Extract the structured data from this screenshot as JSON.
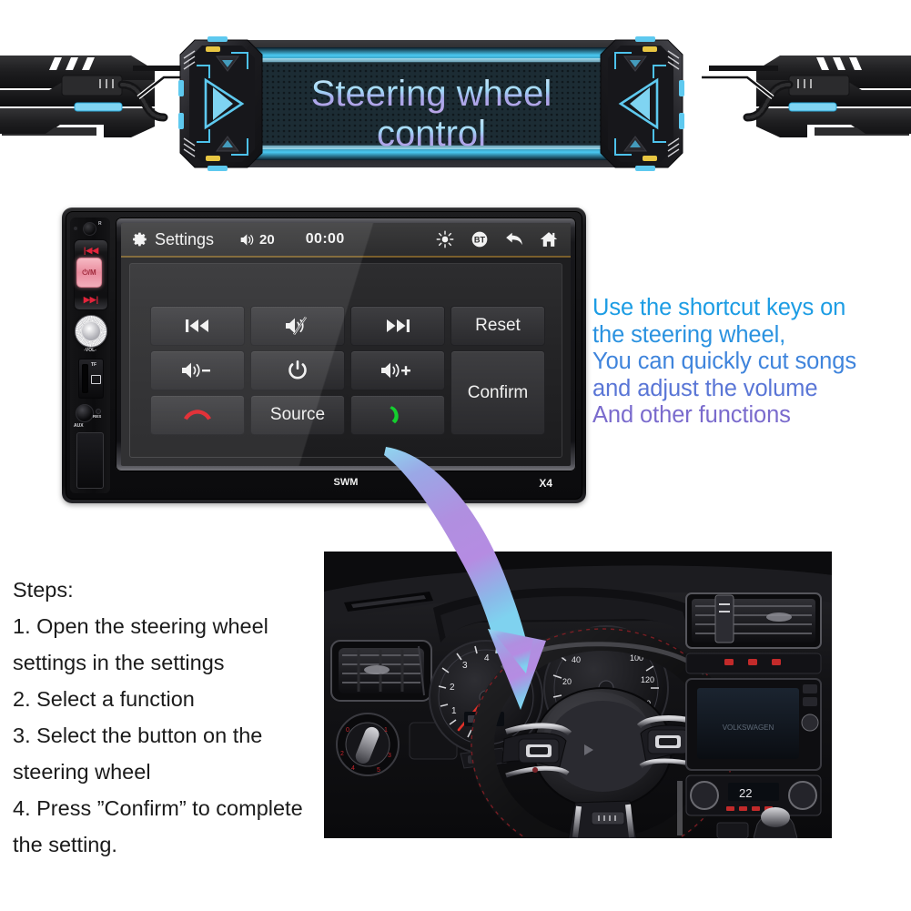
{
  "banner": {
    "title_line1": "Steering wheel",
    "title_line2": "control",
    "left_arrow_icon": "play-triangle-right-icon",
    "right_arrow_icon": "play-triangle-left-icon",
    "accent_cyan": "#56c8f0",
    "accent_purple": "#b3a0e8"
  },
  "stereo": {
    "model_label": "X4",
    "mode_label": "SWM",
    "side_panel": {
      "mic_icon": "microphone-icon",
      "prev_label": "|◀◀",
      "next_label": "▶▶|",
      "power_label": "⏻/M",
      "volume_label": "-VOL-",
      "tf_label": "TF",
      "aux_label": "AUX",
      "res_label": "RES"
    },
    "topbar": {
      "gear_icon": "gear-icon",
      "settings_label": "Settings",
      "volume_icon": "speaker-icon",
      "volume_value": "20",
      "clock": "00:00",
      "brightness_icon": "brightness-sun-icon",
      "bluetooth_icon": "bluetooth-bt-icon",
      "back_icon": "back-arrow-icon",
      "home_icon": "home-icon"
    },
    "keys": [
      {
        "id": "prev-track",
        "icon": "previous-track-icon",
        "label": ""
      },
      {
        "id": "mute",
        "icon": "mute-speaker-icon",
        "label": ""
      },
      {
        "id": "next-track",
        "icon": "next-track-icon",
        "label": ""
      },
      {
        "id": "reset",
        "icon": "",
        "label": "Reset"
      },
      {
        "id": "volume-down",
        "icon": "speaker-minus-icon",
        "label": ""
      },
      {
        "id": "power",
        "icon": "power-icon",
        "label": ""
      },
      {
        "id": "volume-up",
        "icon": "speaker-plus-icon",
        "label": ""
      },
      {
        "id": "confirm",
        "icon": "",
        "label": "Confirm"
      },
      {
        "id": "hang-up",
        "icon": "phone-hangup-icon",
        "label": ""
      },
      {
        "id": "source",
        "icon": "",
        "label": "Source"
      },
      {
        "id": "answer-call",
        "icon": "phone-answer-icon",
        "label": ""
      }
    ]
  },
  "callout": {
    "lines": [
      "Use the shortcut keys on",
      "the steering wheel,",
      "You can quickly cut songs",
      "and adjust the volume",
      "And other functions"
    ],
    "color_top": "#1d9de4",
    "color_bottom": "#7a6bcd"
  },
  "steps": {
    "heading": "Steps:",
    "lines": [
      "1. Open the steering wheel",
      "settings in the settings",
      "2. Select a function",
      "3. Select the button on the",
      "steering wheel",
      "4. Press ”Confirm” to complete",
      "the setting."
    ]
  },
  "photo": {
    "alt_name": "car-dashboard-steering-wheel-photo",
    "arrow_icon": "curved-down-arrow-icon",
    "arrow_color_start": "#9a86e0",
    "arrow_color_end": "#7fd2ef"
  }
}
